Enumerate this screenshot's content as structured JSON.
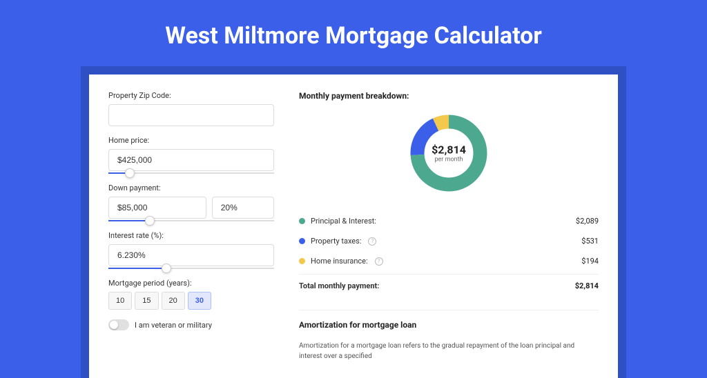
{
  "title": "West Miltmore Mortgage Calculator",
  "form": {
    "zip_label": "Property Zip Code:",
    "zip_value": "",
    "homeprice_label": "Home price:",
    "homeprice_value": "$425,000",
    "homeprice_slider_pct": 10,
    "downpayment_label": "Down payment:",
    "downpayment_value": "$85,000",
    "downpayment_pct_value": "20%",
    "downpayment_slider_pct": 22,
    "interest_label": "Interest rate (%):",
    "interest_value": "6.230%",
    "interest_slider_pct": 32,
    "period_label": "Mortgage period (years):",
    "periods": [
      "10",
      "15",
      "20",
      "30"
    ],
    "period_selected": "30",
    "veteran_label": "I am veteran or military"
  },
  "breakdown": {
    "title": "Monthly payment breakdown:",
    "total_amount": "$2,814",
    "total_sub": "per month",
    "items": [
      {
        "label": "Principal & Interest:",
        "value": "$2,089",
        "color": "#4DA890",
        "pct": 74
      },
      {
        "label": "Property taxes:",
        "value": "$531",
        "color": "#3B5FE8",
        "pct": 19,
        "info": true
      },
      {
        "label": "Home insurance:",
        "value": "$194",
        "color": "#F2C94C",
        "pct": 7,
        "info": true
      }
    ],
    "total_label": "Total monthly payment:",
    "total_value": "$2,814"
  },
  "amortization": {
    "title": "Amortization for mortgage loan",
    "text": "Amortization for a mortgage loan refers to the gradual repayment of the loan principal and interest over a specified"
  },
  "chart_data": {
    "type": "pie",
    "title": "Monthly payment breakdown",
    "series": [
      {
        "name": "Principal & Interest",
        "value": 2089,
        "color": "#4DA890"
      },
      {
        "name": "Property taxes",
        "value": 531,
        "color": "#3B5FE8"
      },
      {
        "name": "Home insurance",
        "value": 194,
        "color": "#F2C94C"
      }
    ],
    "total": 2814,
    "center_label": "$2,814 per month"
  }
}
